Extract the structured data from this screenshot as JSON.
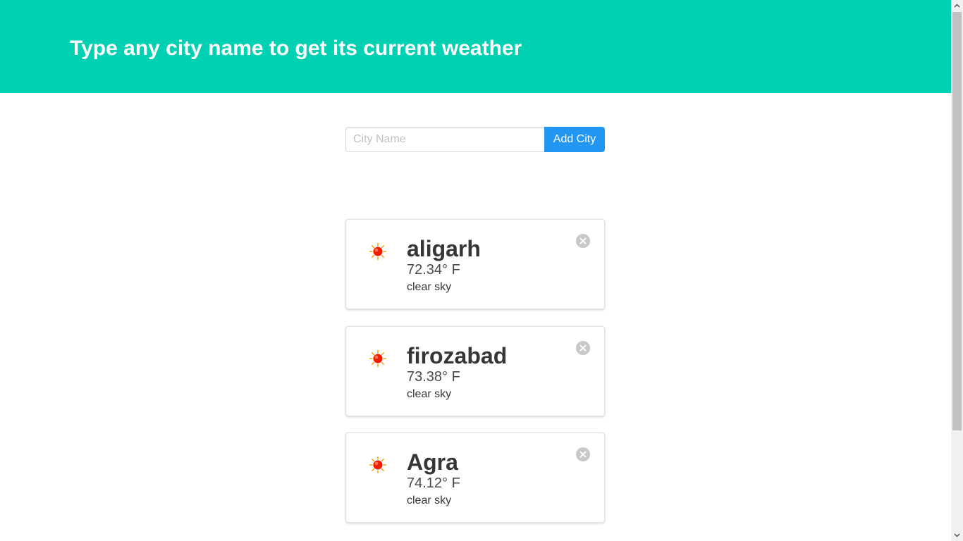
{
  "header": {
    "title": "Type any city name to get its current weather",
    "background_color": "#00d1b2"
  },
  "search": {
    "placeholder": "City Name",
    "value": "",
    "button_label": "Add City",
    "button_color": "#2196f3"
  },
  "cities": [
    {
      "name": "aligarh",
      "temperature": "72.34° F",
      "description": "clear sky",
      "icon": "sun-icon"
    },
    {
      "name": "firozabad",
      "temperature": "73.38° F",
      "description": "clear sky",
      "icon": "sun-icon"
    },
    {
      "name": "Agra",
      "temperature": "74.12° F",
      "description": "clear sky",
      "icon": "sun-icon"
    }
  ],
  "icons": {
    "weather": "sun-icon",
    "delete": "close-circle-icon",
    "scroll_up": "chevron-up-icon",
    "scroll_down": "chevron-down-icon"
  }
}
